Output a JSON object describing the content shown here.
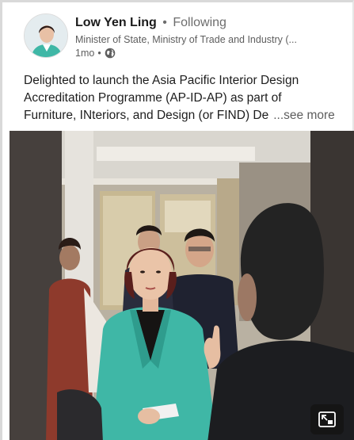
{
  "post": {
    "author_name": "Low Yen Ling",
    "separator": "•",
    "follow_status": "Following",
    "author_title": "Minister of State, Ministry of Trade and Industry (...",
    "time_ago": "1mo",
    "meta_separator": "•",
    "visibility_icon": "globe-icon",
    "text_lines": [
      "Delighted to launch the Asia Pacific Interior Design",
      "Accreditation Programme (AP-ID-AP) as part of",
      "Furniture, INteriors, and Design (or FIND) De"
    ],
    "see_more_label": "...see more"
  },
  "video": {
    "pip_icon": "picture-in-picture-icon"
  },
  "colors": {
    "primary_text": "#1d1d1d",
    "secondary_text": "#5e5e5e",
    "blazer": "#3fb7a6"
  }
}
